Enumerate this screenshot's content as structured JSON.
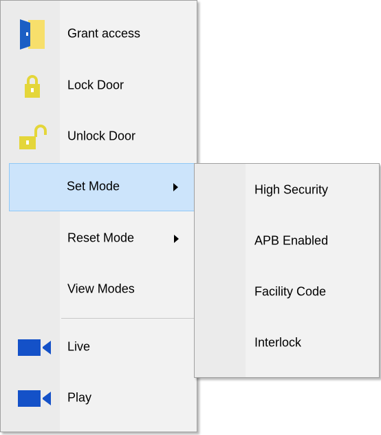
{
  "context_menu": {
    "items": [
      {
        "label": "Grant access",
        "icon": "door-open-icon"
      },
      {
        "label": "Lock Door",
        "icon": "lock-closed-icon"
      },
      {
        "label": "Unlock Door",
        "icon": "lock-open-icon"
      },
      {
        "label": "Set Mode",
        "icon": "",
        "has_submenu": true,
        "selected": true
      },
      {
        "label": "Reset Mode",
        "icon": "",
        "has_submenu": true
      },
      {
        "label": "View Modes",
        "icon": ""
      },
      {
        "label": "Live",
        "icon": "video-camera-icon"
      },
      {
        "label": "Play",
        "icon": "video-camera-icon"
      }
    ]
  },
  "submenu": {
    "parent": "Set Mode",
    "items": [
      {
        "label": "High Security"
      },
      {
        "label": "APB Enabled"
      },
      {
        "label": "Facility Code"
      },
      {
        "label": "Interlock"
      }
    ]
  },
  "colors": {
    "menu_background": "#f2f2f2",
    "icon_gutter": "#ebebeb",
    "highlight": "#cce4fb",
    "highlight_border": "#90c8f6",
    "door_blue": "#1b5fc4",
    "door_yellow": "#f7df6b",
    "lock_yellow": "#e4d63a",
    "camera_blue": "#1451c8"
  }
}
